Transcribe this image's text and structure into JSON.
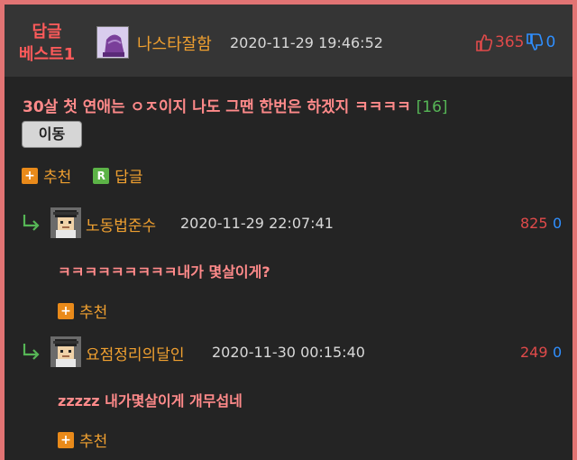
{
  "header": {
    "best_label_line1": "답글",
    "best_label_line2": "베스트1",
    "author": "나스타잘함",
    "date": "2020-11-29 19:46:52",
    "upvotes": "365",
    "downvotes": "0"
  },
  "post": {
    "text": "30살 첫 연애는 ㅇㅈ이지 나도 그땐 한번은 하겠지 ㅋㅋㅋㅋ",
    "reply_count": "[16]",
    "move_button": "이동",
    "recommend_label": "추천",
    "recommend_icon": "+",
    "reply_label": "답글",
    "reply_icon": "R"
  },
  "replies": [
    {
      "author": "노동법준수",
      "date": "2020-11-29 22:07:41",
      "upvotes": "825",
      "downvotes": "0",
      "text": "ㅋㅋㅋㅋㅋㅋㅋㅋㅋ내가 몇살이게?",
      "recommend_label": "추천",
      "recommend_icon": "+"
    },
    {
      "author": "요점정리의달인",
      "date": "2020-11-30 00:15:40",
      "upvotes": "249",
      "downvotes": "0",
      "text": "zzzzz 내가몇살이게 개무섭네",
      "recommend_label": "추천",
      "recommend_icon": "+"
    }
  ],
  "colors": {
    "border": "#e27474",
    "author": "#f0a030",
    "text": "#ff8a8a",
    "upvote": "#e04a4a",
    "downvote": "#2f8fff",
    "count": "#56b656"
  },
  "icons": {
    "header_avatar": "purple-hat-avatar-icon",
    "reply_avatar": "pixel-person-avatar-icon",
    "reply_arrow": "reply-arrow-icon",
    "thumbs_up": "thumbs-up-icon",
    "thumbs_down": "thumbs-down-icon"
  }
}
